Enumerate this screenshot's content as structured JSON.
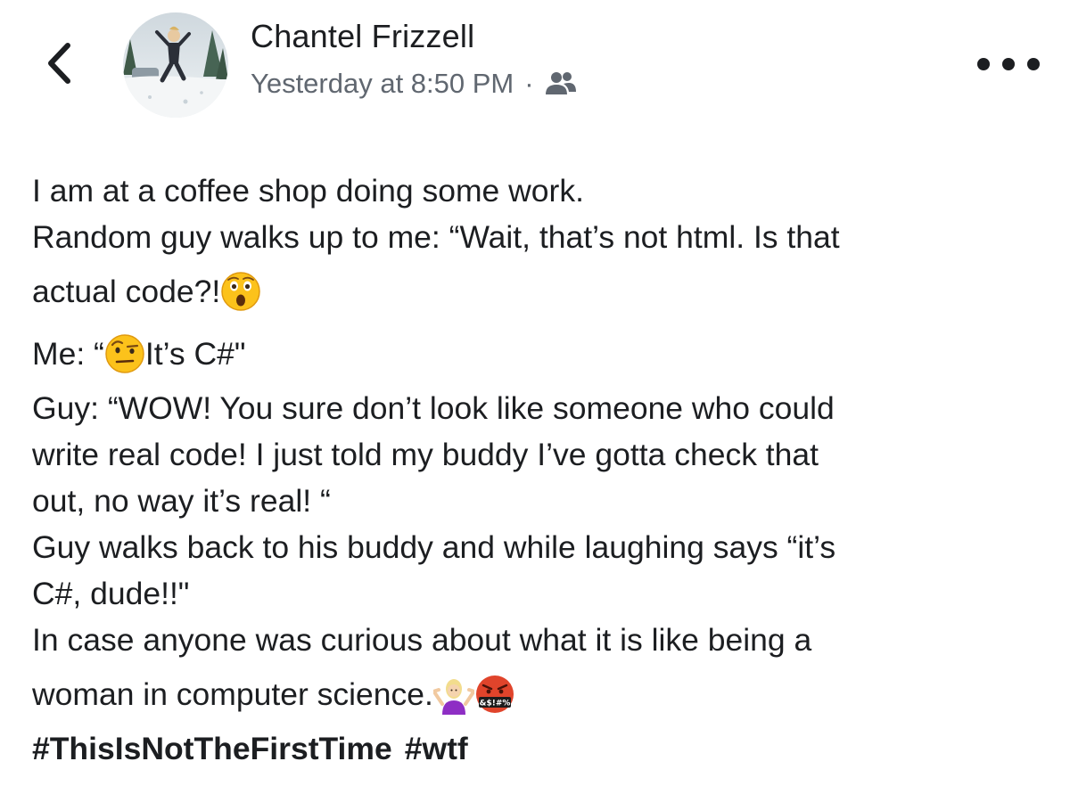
{
  "post": {
    "author": "Chantel Frizzell",
    "timestamp": "Yesterday at 8:50 PM",
    "separator": "·",
    "audience_icon": "friends-icon",
    "lines": {
      "l1": "I am at a coffee shop doing some work.",
      "l2": "Random guy walks up to me: “Wait, that’s not html. Is that",
      "l3": "actual code?!",
      "l4a": "Me: “",
      "l4b": " It’s C#\"",
      "l5": "Guy: “WOW! You sure don’t look like someone who could",
      "l6": "write real code! I just told my buddy I’ve gotta check that",
      "l7": "out, no way it’s real! “",
      "l8": "Guy walks back to his buddy and while laughing says “it’s",
      "l9": "C#, dude!!\"",
      "l10": "In case anyone was curious about what it is like being a",
      "l11": "woman in computer science. "
    },
    "emoji": {
      "astonished": "astonished-face-emoji",
      "raised_eyebrow": "raised-eyebrow-face-emoji",
      "shrug": "person-shrugging-emoji",
      "cursing": "face-with-symbols-emoji",
      "cursing_text": "&$!#%"
    },
    "hashtags": [
      "#ThisIsNotTheFirstTime",
      "#wtf"
    ]
  },
  "colors": {
    "text": "#1c1e21",
    "meta": "#606770",
    "cursing_face": "#e0442b"
  }
}
